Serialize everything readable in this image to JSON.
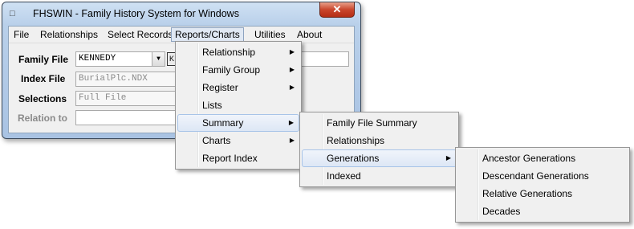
{
  "window": {
    "title": "FHSWIN - Family History System  for  Windows",
    "close_label": "✕"
  },
  "menubar": [
    "File",
    "Relationships",
    "Select Records",
    "Reports/Charts",
    "Utilities",
    "About"
  ],
  "form": {
    "family_file": {
      "label": "Family File",
      "value": "KENNEDY"
    },
    "index_file": {
      "label": "Index File",
      "value": "BurialPlc.NDX"
    },
    "selections": {
      "label": "Selections",
      "value": "Full File"
    },
    "relation_to": {
      "label": "Relation to",
      "value": ""
    }
  },
  "reports_menu": {
    "items": [
      "Relationship",
      "Family Group",
      "Register",
      "Lists",
      "Summary",
      "Charts",
      "Report Index"
    ],
    "submenu_flags": [
      true,
      true,
      true,
      false,
      true,
      true,
      false
    ],
    "highlighted": "Summary"
  },
  "summary_menu": {
    "items": [
      "Family File Summary",
      "Relationships",
      "Generations",
      "Indexed"
    ],
    "highlighted": "Generations"
  },
  "generations_menu": {
    "items": [
      "Ancestor Generations",
      "Descendant Generations",
      "Relative Generations",
      "Decades"
    ]
  },
  "icons": {
    "app_icon": "app-icon",
    "submenu_arrow": "▶",
    "combo_arrow": "▼"
  }
}
